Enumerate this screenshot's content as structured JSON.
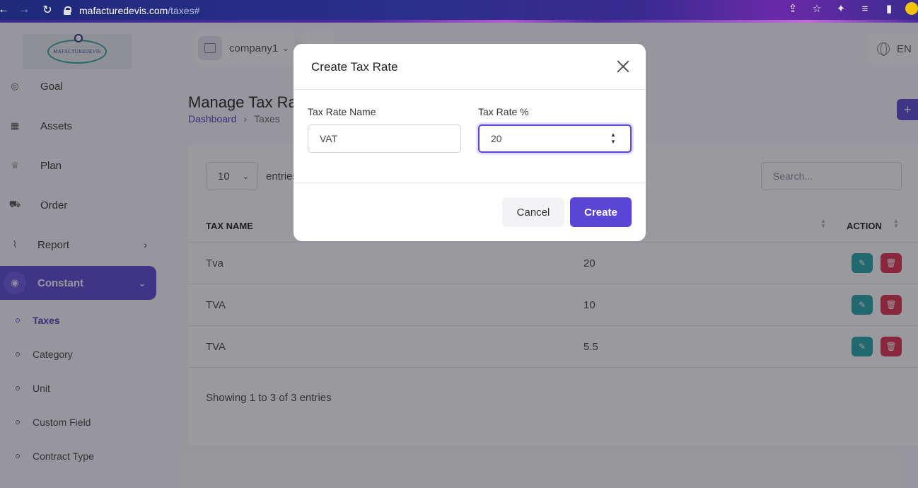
{
  "browser": {
    "url_host": "mafacturedevis.com",
    "url_path": "/taxes#"
  },
  "header": {
    "company_name": "company1",
    "language": "EN"
  },
  "logo": {
    "text": "MAFACTUREDEVIS"
  },
  "sidebar": {
    "items": [
      {
        "label": "Goal",
        "icon": "target-icon"
      },
      {
        "label": "Assets",
        "icon": "calculator-icon"
      },
      {
        "label": "Plan",
        "icon": "trophy-icon"
      },
      {
        "label": "Order",
        "icon": "cart-icon"
      },
      {
        "label": "Report",
        "icon": "chart-icon"
      },
      {
        "label": "Constant",
        "icon": "settings-icon"
      }
    ],
    "subitems": [
      "Taxes",
      "Category",
      "Unit",
      "Custom Field",
      "Contract Type"
    ]
  },
  "page": {
    "title": "Manage Tax Rat",
    "breadcrumb": {
      "home": "Dashboard",
      "current": "Taxes"
    },
    "add_label": "+"
  },
  "table": {
    "page_size": "10",
    "entries_label": "entries",
    "search_placeholder": "Search...",
    "headers": {
      "name": "TAX NAME",
      "action": "ACTION"
    },
    "rows": [
      {
        "name": "Tva",
        "rate": "20"
      },
      {
        "name": "TVA",
        "rate": "10"
      },
      {
        "name": "TVA",
        "rate": "5.5"
      }
    ],
    "showing": "Showing 1 to 3 of 3 entries"
  },
  "modal": {
    "title": "Create Tax Rate",
    "name_label": "Tax Rate Name",
    "name_value": "VAT",
    "rate_label": "Tax Rate %",
    "rate_value": "20",
    "cancel_label": "Cancel",
    "create_label": "Create"
  },
  "colors": {
    "accent": "#5b45d6",
    "edit": "#23a5a9",
    "delete": "#e0314f"
  }
}
